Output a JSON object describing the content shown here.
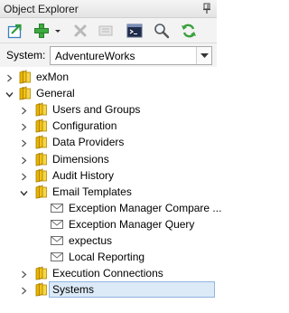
{
  "window": {
    "title": "Object Explorer"
  },
  "toolbar": {
    "buttons": [
      {
        "name": "export-icon"
      },
      {
        "name": "add-icon"
      },
      {
        "name": "add-dropdown-icon"
      },
      {
        "name": "delete-icon"
      },
      {
        "name": "properties-icon"
      },
      {
        "name": "console-icon"
      },
      {
        "name": "search-icon"
      },
      {
        "name": "refresh-icon"
      }
    ]
  },
  "system": {
    "label": "System:",
    "value": "AdventureWorks"
  },
  "tree": [
    {
      "label": "exMon",
      "level": 0,
      "expander": "collapsed",
      "icon": "folder-icon"
    },
    {
      "label": "General",
      "level": 0,
      "expander": "expanded",
      "icon": "folder-icon"
    },
    {
      "label": "Users and Groups",
      "level": 1,
      "expander": "collapsed",
      "icon": "folder-icon"
    },
    {
      "label": "Configuration",
      "level": 1,
      "expander": "collapsed",
      "icon": "folder-icon"
    },
    {
      "label": "Data Providers",
      "level": 1,
      "expander": "collapsed",
      "icon": "folder-icon"
    },
    {
      "label": "Dimensions",
      "level": 1,
      "expander": "collapsed",
      "icon": "folder-icon"
    },
    {
      "label": "Audit History",
      "level": 1,
      "expander": "collapsed",
      "icon": "folder-icon"
    },
    {
      "label": "Email Templates",
      "level": 1,
      "expander": "expanded",
      "icon": "folder-icon"
    },
    {
      "label": "Exception Manager Compare ...",
      "level": 2,
      "expander": "none",
      "icon": "envelope-icon"
    },
    {
      "label": "Exception Manager Query",
      "level": 2,
      "expander": "none",
      "icon": "envelope-icon"
    },
    {
      "label": "expectus",
      "level": 2,
      "expander": "none",
      "icon": "envelope-icon"
    },
    {
      "label": "Local Reporting",
      "level": 2,
      "expander": "none",
      "icon": "envelope-icon"
    },
    {
      "label": "Execution Connections",
      "level": 1,
      "expander": "collapsed",
      "icon": "folder-icon"
    },
    {
      "label": "Systems",
      "level": 1,
      "expander": "collapsed",
      "icon": "folder-icon",
      "selected": true
    }
  ]
}
